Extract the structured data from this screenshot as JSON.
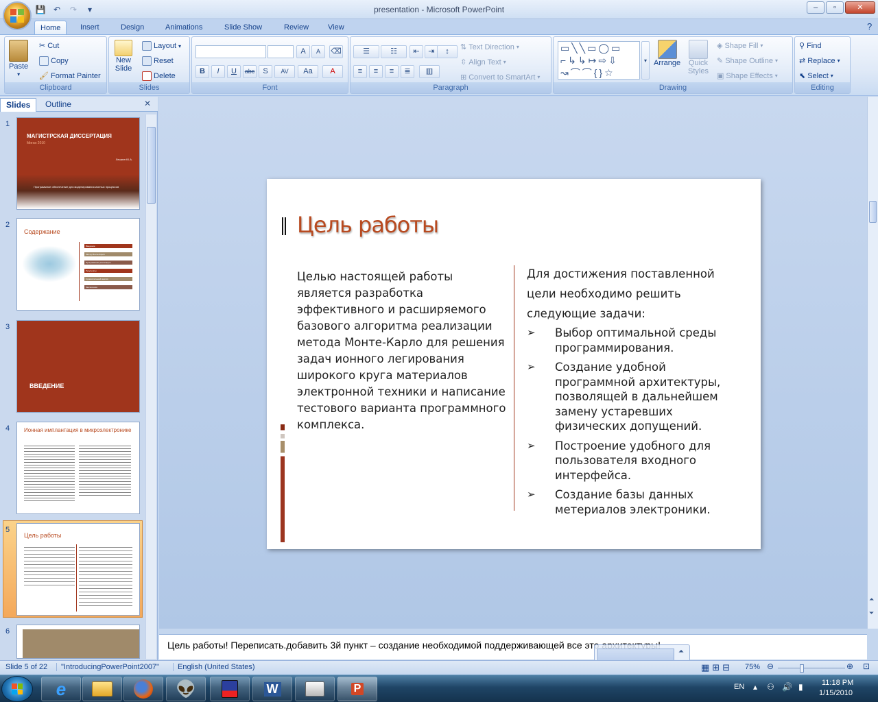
{
  "window": {
    "title": "presentation - Microsoft PowerPoint",
    "controls": [
      "–",
      "▫",
      "✕"
    ]
  },
  "tabs": [
    "Home",
    "Insert",
    "Design",
    "Animations",
    "Slide Show",
    "Review",
    "View"
  ],
  "ribbon": {
    "clipboard": {
      "paste": "Paste",
      "cut": "Cut",
      "copy": "Copy",
      "format_painter": "Format Painter",
      "label": "Clipboard"
    },
    "slides": {
      "new_slide": "New",
      "new_slide2": "Slide",
      "layout": "Layout",
      "reset": "Reset",
      "delete": "Delete",
      "label": "Slides"
    },
    "font": {
      "label": "Font",
      "bold": "B",
      "italic": "I",
      "underline": "U",
      "strike": "abc",
      "shadow": "S",
      "spacing": "AV",
      "case": "Aa",
      "color": "A"
    },
    "paragraph": {
      "text_direction": "Text Direction",
      "align_text": "Align Text",
      "smartart": "Convert to SmartArt",
      "label": "Paragraph"
    },
    "drawing": {
      "arrange": "Arrange",
      "quick_styles": "Quick",
      "quick_styles2": "Styles",
      "shape_fill": "Shape Fill",
      "shape_outline": "Shape Outline",
      "shape_effects": "Shape Effects",
      "label": "Drawing"
    },
    "editing": {
      "find": "Find",
      "replace": "Replace",
      "select": "Select",
      "label": "Editing"
    }
  },
  "pane": {
    "tabs": [
      "Slides",
      "Outline"
    ],
    "thumbs": [
      {
        "num": "1",
        "title": "МАГИСТРСКАЯ ДИССЕРТАЦИЯ",
        "sub": "Минск 2010",
        "author": "Лешкин Ю.А.",
        "footer": "Программное обеспечение для моделирования ионных процессов"
      },
      {
        "num": "2",
        "title": "Содержание",
        "items": [
          "Введение",
          "Метод Монте-Карло",
          "Программная реализация",
          "Результаты",
          "Сравнительный анализ",
          "Заключение"
        ]
      },
      {
        "num": "3",
        "title": "ВВЕДЕНИЕ"
      },
      {
        "num": "4",
        "title": "Ионная имплантация в микроэлектронике"
      },
      {
        "num": "5",
        "title": "Цель работы"
      },
      {
        "num": "6"
      }
    ]
  },
  "slide": {
    "title": "Цель работы",
    "left_text": "Целью настоящей работы является  разработка эффективного и расширяемого базового  алгоритма реализации метода  Монте-Карло для решения задач  ионного легирования широкого круга материалов электронной техники и написание тестового варианта программного комплекса.",
    "right_intro": "Для достижения поставленной цели необходимо решить следующие задачи:",
    "bullets": [
      "Выбор оптимальной среды программирования.",
      "Создание удобной программной архитектуры, позволящей в дальнейшем замену устаревших физических допущений.",
      "Построение удобного для пользователя входного интерфейса.",
      "Создание базы данных метериалов электроники."
    ],
    "bullet_glyph": "➢"
  },
  "notes": "Цель работы! Переписать.добавить 3й пункт – создание необходимой поддерживающей все это архитектуры!",
  "status": {
    "slide": "Slide 5 of 22",
    "theme": "\"IntroducingPowerPoint2007\"",
    "lang": "English (United States)",
    "zoom": "75%"
  },
  "tray": {
    "lang": "EN",
    "time": "11:18 PM",
    "date": "1/15/2010"
  },
  "colors": {
    "accent": "#b84a20",
    "thumb_red": "#a0351c",
    "thumb_tan": "#a08a6a"
  }
}
